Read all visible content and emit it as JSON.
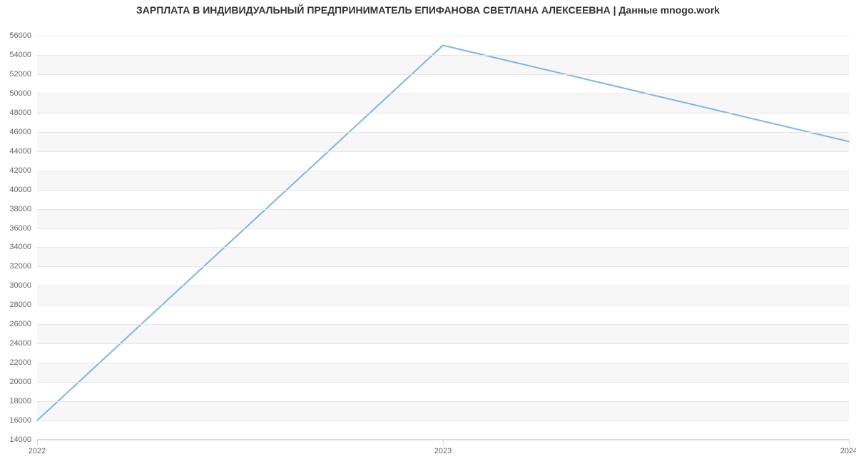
{
  "chart_data": {
    "type": "line",
    "title": "ЗАРПЛАТА В ИНДИВИДУАЛЬНЫЙ ПРЕДПРИНИМАТЕЛЬ ЕПИФАНОВА СВЕТЛАНА АЛЕКСЕЕВНА | Данные mnogo.work",
    "x": [
      2022,
      2023,
      2024
    ],
    "values": [
      16000,
      55000,
      45000
    ],
    "xlabel": "",
    "ylabel": "",
    "ylim": [
      14000,
      56000
    ],
    "xlim": [
      2022,
      2024
    ],
    "y_ticks": [
      14000,
      16000,
      18000,
      20000,
      22000,
      24000,
      26000,
      28000,
      30000,
      32000,
      34000,
      36000,
      38000,
      40000,
      42000,
      44000,
      46000,
      48000,
      50000,
      52000,
      54000,
      56000
    ],
    "x_ticks": [
      2022,
      2023,
      2024
    ],
    "line_color": "#7cb5ec",
    "grid": true
  }
}
